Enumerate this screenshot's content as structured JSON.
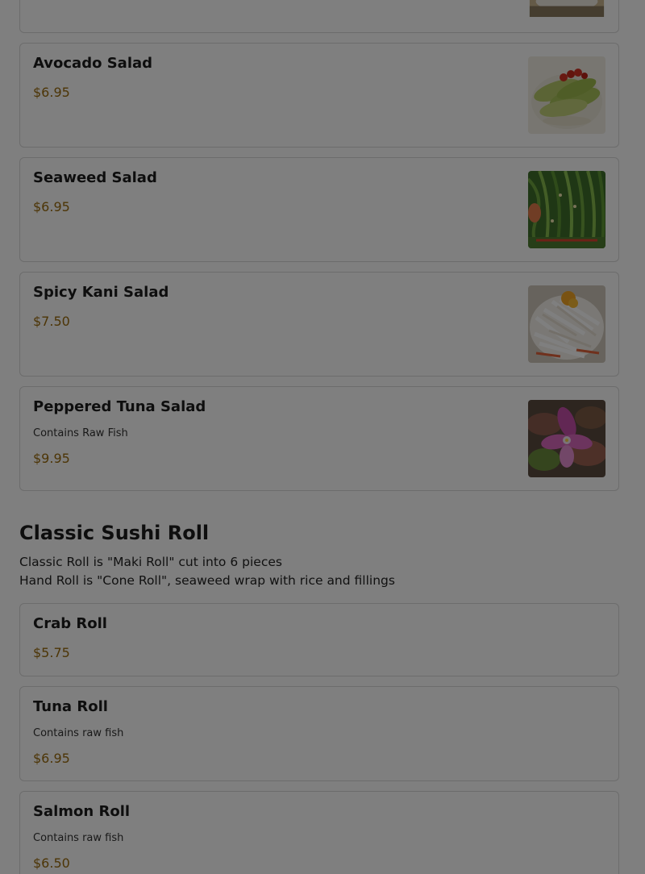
{
  "salads": [
    {
      "name": "Avocado Salad",
      "note": "",
      "price": "$6.95",
      "image": "avocado-salad-photo"
    },
    {
      "name": "Seaweed Salad",
      "note": "",
      "price": "$6.95",
      "image": "seaweed-salad-photo"
    },
    {
      "name": "Spicy Kani Salad",
      "note": "",
      "price": "$7.50",
      "image": "spicy-kani-salad-photo"
    },
    {
      "name": "Peppered Tuna Salad",
      "note": "Contains Raw Fish",
      "price": "$9.95",
      "image": "peppered-tuna-salad-photo"
    }
  ],
  "classic_section": {
    "title": "Classic Sushi Roll",
    "desc_line1": "Classic Roll is \"Maki Roll\" cut into 6 pieces",
    "desc_line2": "Hand Roll is \"Cone Roll\", seaweed wrap with rice and fillings"
  },
  "rolls": [
    {
      "name": "Crab Roll",
      "note": "",
      "price": "$5.75"
    },
    {
      "name": "Tuna Roll",
      "note": "Contains raw fish",
      "price": "$6.95"
    },
    {
      "name": "Salmon Roll",
      "note": "Contains raw fish",
      "price": "$6.50"
    }
  ],
  "colors": {
    "price": "#9a6b0c",
    "overlay": "rgba(0,0,0,0.5)"
  }
}
